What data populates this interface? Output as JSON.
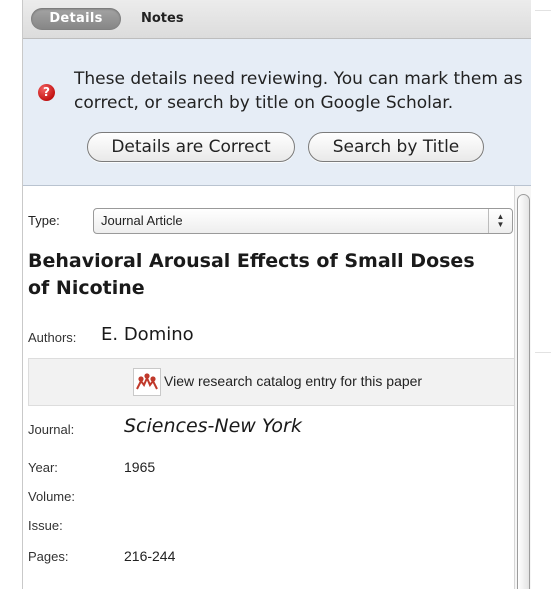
{
  "tabs": {
    "details": "Details",
    "notes": "Notes"
  },
  "warning": {
    "icon": "warning-icon",
    "message": "These details need reviewing. You can mark them as correct, or search by title on Google Scholar.",
    "correct_button": "Details are Correct",
    "search_button": "Search by Title",
    "background_color": "#e6edf6",
    "icon_color": "#c41414"
  },
  "details": {
    "type_label": "Type:",
    "type_value": "Journal Article",
    "title": "Behavioral Arousal Effects of Small Doses of Nicotine",
    "authors_label": "Authors:",
    "authors_value": "E. Domino",
    "catalog_link": "View research catalog entry for this paper",
    "catalog_icon": "research-catalog-icon",
    "catalog_icon_color": "#c0392b",
    "journal_label": "Journal:",
    "journal_value": "Sciences-New York",
    "year_label": "Year:",
    "year_value": "1965",
    "volume_label": "Volume:",
    "volume_value": "",
    "issue_label": "Issue:",
    "issue_value": "",
    "pages_label": "Pages:",
    "pages_value": "216-244"
  }
}
